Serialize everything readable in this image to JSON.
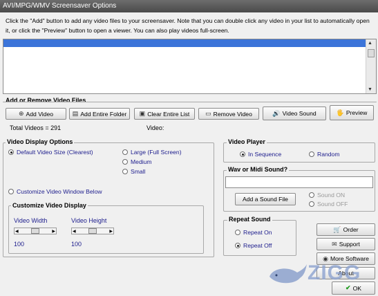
{
  "window": {
    "title": "AVI/MPG/WMV Screensaver Options"
  },
  "instructions": "Click the \"Add\" button to add any video files to your screensaver. Note that you can double click any video in your list to automatically open it, or click the \"Preview\" button to open a viewer. You can also play videos full-screen.",
  "add_remove": {
    "title": "Add or Remove Video Files",
    "buttons": {
      "add_video": "Add Video",
      "add_folder": "Add Entire Folder",
      "clear_list": "Clear Entire List",
      "remove_video": "Remove Video",
      "video_sound": "Video Sound",
      "preview": "Preview"
    },
    "total_videos": "Total Videos = 291",
    "video_label": "Video:"
  },
  "display_options": {
    "title": "Video Display Options",
    "default_size": "Default Video Size (Clearest)",
    "large": "Large (Full Screen)",
    "medium": "Medium",
    "small": "Small",
    "customize": "Customize Video Window Below",
    "selected": "default"
  },
  "customize_display": {
    "title": "Customize Video Display",
    "width_label": "Video Width",
    "height_label": "Video Height",
    "width_value": "100",
    "height_value": "100"
  },
  "video_player": {
    "title": "Video Player",
    "in_sequence": "In Sequence",
    "random": "Random",
    "selected": "in_sequence"
  },
  "sound": {
    "title": "Wav or Midi Sound?",
    "file_value": "",
    "add_button": "Add a Sound File",
    "sound_on": "Sound ON",
    "sound_off": "Sound OFF"
  },
  "repeat_sound": {
    "title": "Repeat Sound",
    "on": "Repeat On",
    "off": "Repeat Off",
    "selected": "off"
  },
  "side_buttons": {
    "order": "Order",
    "support": "Support",
    "more_software": "More Software",
    "about": "About",
    "ok": "OK"
  },
  "watermark": "ZIGG",
  "colors": {
    "selection": "#3b74d9",
    "label_blue": "#1c1c8c",
    "ok_check": "#1a9a1a"
  }
}
